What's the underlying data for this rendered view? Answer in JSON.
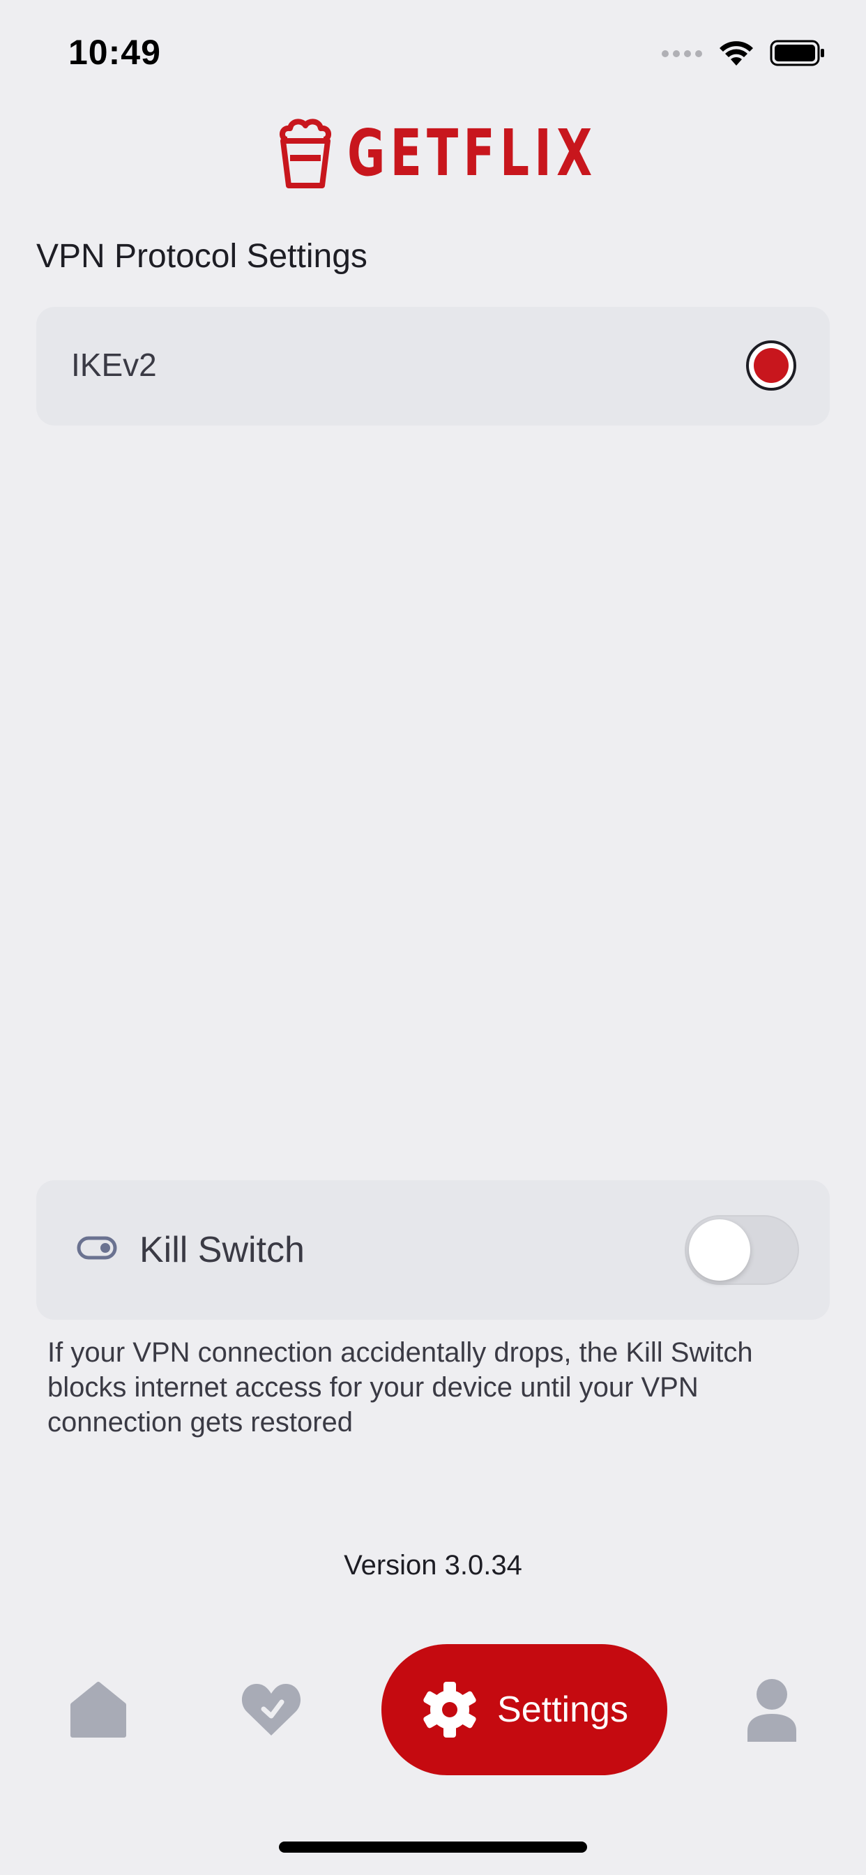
{
  "status_bar": {
    "time": "10:49"
  },
  "header": {
    "logo_text": "GETFLIX",
    "brand_color": "#c8161d"
  },
  "vpn_protocol": {
    "title": "VPN Protocol Settings",
    "options": [
      {
        "label": "IKEv2",
        "selected": true
      }
    ]
  },
  "kill_switch": {
    "label": "Kill Switch",
    "enabled": false,
    "description": "If your VPN connection accidentally drops, the Kill Switch blocks internet access for your device until your VPN connection gets restored"
  },
  "footer": {
    "version": "Version 3.0.34"
  },
  "tab_bar": {
    "items": [
      {
        "icon": "home-icon",
        "active": false
      },
      {
        "icon": "heart-icon",
        "active": false
      },
      {
        "icon": "gear-icon",
        "label": "Settings",
        "active": true
      },
      {
        "icon": "user-icon",
        "active": false
      }
    ],
    "active_color": "#c50a10",
    "inactive_color": "#a8abb6"
  }
}
